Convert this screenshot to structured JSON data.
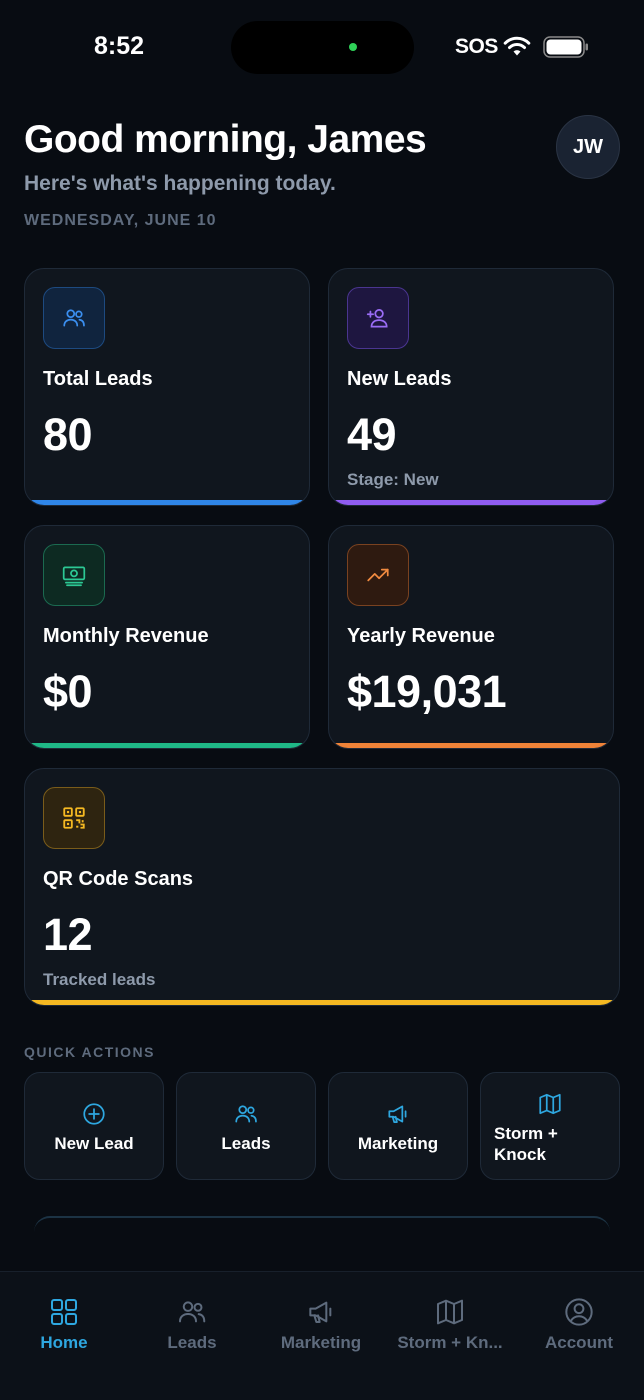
{
  "status_bar": {
    "time": "8:52",
    "carrier": "SOS"
  },
  "header": {
    "greeting": "Good morning, James",
    "subtitle": "Here's what's happening today.",
    "date": "WEDNESDAY, JUNE 10",
    "avatar_initials": "JW"
  },
  "stats": {
    "total_leads": {
      "label": "Total Leads",
      "value": "80",
      "icon": "users-icon",
      "accent": "#2f86e8"
    },
    "new_leads": {
      "label": "New Leads",
      "value": "49",
      "sub": "Stage: New",
      "icon": "user-plus-icon",
      "accent": "#8f5cf0"
    },
    "monthly_revenue": {
      "label": "Monthly Revenue",
      "value": "$0",
      "icon": "cash-icon",
      "accent": "#1fb887"
    },
    "yearly_revenue": {
      "label": "Yearly Revenue",
      "value": "$19,031",
      "icon": "trending-up-icon",
      "accent": "#ef8338"
    },
    "qr_scans": {
      "label": "QR Code Scans",
      "value": "12",
      "sub": "Tracked leads",
      "icon": "qr-code-icon",
      "accent": "#f5b922"
    }
  },
  "quick_actions": {
    "title": "QUICK ACTIONS",
    "items": [
      {
        "label": "New Lead",
        "icon": "plus-circle-icon"
      },
      {
        "label": "Leads",
        "icon": "users-icon"
      },
      {
        "label": "Marketing",
        "icon": "megaphone-icon"
      },
      {
        "label_line1": "Storm +",
        "label_line2": "Knock",
        "icon": "map-icon"
      }
    ]
  },
  "tab_bar": {
    "items": [
      {
        "label": "Home",
        "icon": "grid-icon",
        "active": true
      },
      {
        "label": "Leads",
        "icon": "users-icon"
      },
      {
        "label": "Marketing",
        "icon": "megaphone-icon"
      },
      {
        "label": "Storm + Kn...",
        "icon": "map-icon"
      },
      {
        "label": "Account",
        "icon": "account-icon"
      }
    ]
  },
  "colors": {
    "background": "#080c12",
    "card": "#10161e",
    "accent_active": "#2ea7e0",
    "muted_text": "#8e9aab"
  }
}
